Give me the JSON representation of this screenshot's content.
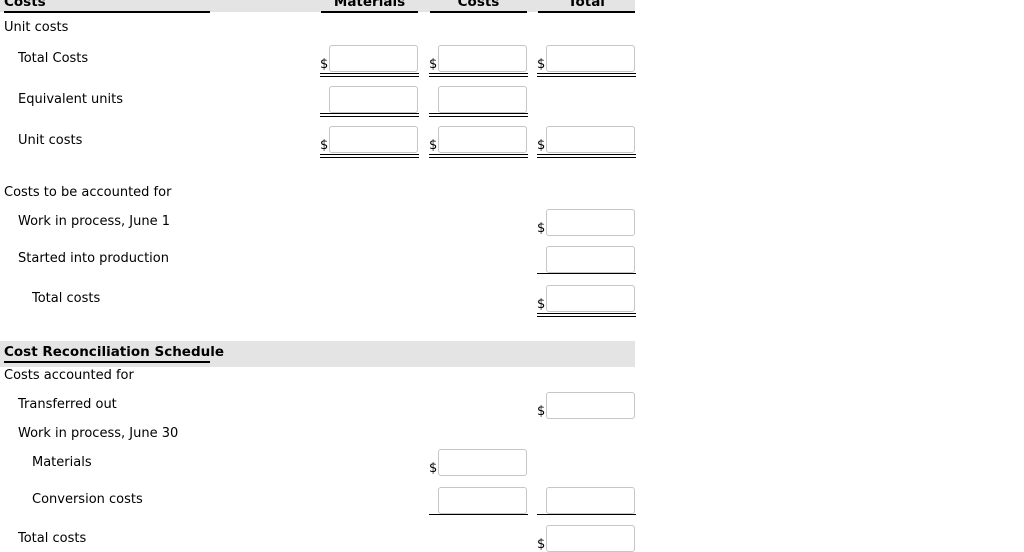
{
  "worksheet": {
    "section_costs": {
      "header_label": "Costs",
      "columns": [
        {
          "label": "Materials"
        },
        {
          "label": "Costs"
        },
        {
          "label": "Total"
        }
      ],
      "rows": [
        {
          "label": "Unit costs",
          "indent": 0,
          "cells": []
        },
        {
          "label": "Total Costs",
          "indent": 1,
          "cells": [
            {
              "column": "Materials",
              "dollar": "$",
              "value": "",
              "underline": "double"
            },
            {
              "column": "Costs",
              "dollar": "$",
              "value": "",
              "underline": "double"
            },
            {
              "column": "Total",
              "dollar": "$",
              "value": "",
              "underline": "double"
            }
          ]
        },
        {
          "label": "Equivalent units",
          "indent": 1,
          "cells": [
            {
              "column": "Materials",
              "dollar": "",
              "value": "",
              "underline": "double"
            },
            {
              "column": "Costs",
              "dollar": "",
              "value": "",
              "underline": "double"
            }
          ]
        },
        {
          "label": "Unit costs",
          "indent": 1,
          "cells": [
            {
              "column": "Materials",
              "dollar": "$",
              "value": "",
              "underline": "double"
            },
            {
              "column": "Costs",
              "dollar": "$",
              "value": "",
              "underline": "double"
            },
            {
              "column": "Total",
              "dollar": "$",
              "value": "",
              "underline": "double"
            }
          ]
        },
        {
          "label": "Costs to be accounted for",
          "indent": 0,
          "cells": []
        },
        {
          "label": "Work in process, June 1",
          "indent": 1,
          "cells": [
            {
              "column": "Total",
              "dollar": "$",
              "value": "",
              "underline": "none"
            }
          ]
        },
        {
          "label": "Started into production",
          "indent": 1,
          "cells": [
            {
              "column": "Total",
              "dollar": "",
              "value": "",
              "underline": "single"
            }
          ]
        },
        {
          "label": "Total costs",
          "indent": 2,
          "cells": [
            {
              "column": "Total",
              "dollar": "$",
              "value": "",
              "underline": "double"
            }
          ]
        }
      ]
    },
    "section_reconciliation": {
      "header_label": "Cost Reconciliation Schedule",
      "rows": [
        {
          "label": "Costs accounted for",
          "indent": 0,
          "cells": []
        },
        {
          "label": "Transferred out",
          "indent": 1,
          "cells": [
            {
              "column": "Total",
              "dollar": "$",
              "value": "",
              "underline": "none"
            }
          ]
        },
        {
          "label": "Work in process, June 30",
          "indent": 1,
          "cells": []
        },
        {
          "label": "Materials",
          "indent": 2,
          "cells": [
            {
              "column": "Costs",
              "dollar": "$",
              "value": "",
              "underline": "none"
            }
          ]
        },
        {
          "label": "Conversion costs",
          "indent": 2,
          "cells": [
            {
              "column": "Costs",
              "dollar": "",
              "value": "",
              "underline": "single"
            },
            {
              "column": "Total",
              "dollar": "",
              "value": "",
              "underline": "single"
            }
          ]
        },
        {
          "label": "Total costs",
          "indent": 1,
          "cells": [
            {
              "column": "Total",
              "dollar": "$",
              "value": "",
              "underline": "none"
            }
          ]
        }
      ]
    },
    "colors": {
      "band_background": "#e4e4e4",
      "rule": "#000000",
      "input_border": "#c6c6c6",
      "page_background": "#ffffff"
    }
  }
}
